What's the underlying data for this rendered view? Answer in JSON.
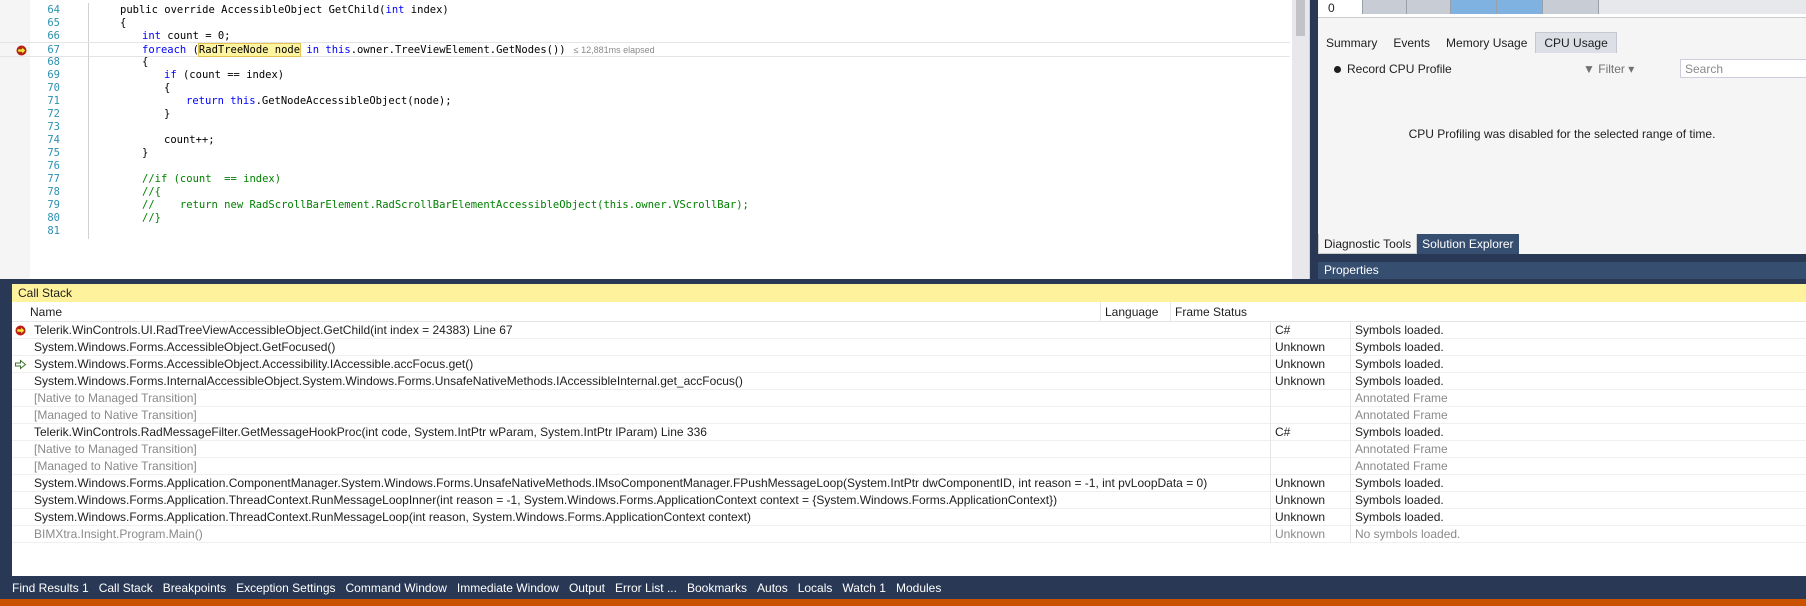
{
  "editor": {
    "lines": [
      {
        "num": "64",
        "parts": [
          [
            "",
            "public override AccessibleObject GetChild("
          ],
          [
            "kw",
            "int"
          ],
          [
            "",
            " index)"
          ]
        ],
        "indent": 3
      },
      {
        "num": "65",
        "parts": [
          [
            "",
            "{"
          ]
        ],
        "indent": 3
      },
      {
        "num": "66",
        "parts": [
          [
            "kw",
            "int"
          ],
          [
            "",
            " count = 0;"
          ]
        ],
        "indent": 4
      },
      {
        "num": "67",
        "parts": [
          [
            "kw",
            "foreach"
          ],
          [
            "",
            " ("
          ],
          [
            "hl",
            "RadTreeNode node"
          ],
          [
            "",
            " "
          ],
          [
            "kw",
            "in"
          ],
          [
            "",
            " "
          ],
          [
            "kw",
            "this"
          ],
          [
            "",
            ".owner.TreeViewElement.GetNodes())"
          ]
        ],
        "indent": 4,
        "current": true,
        "perf": "≤ 12,881ms elapsed"
      },
      {
        "num": "68",
        "parts": [
          [
            "",
            "{"
          ]
        ],
        "indent": 4
      },
      {
        "num": "69",
        "parts": [
          [
            "kw",
            "if"
          ],
          [
            "",
            " (count == index)"
          ]
        ],
        "indent": 5
      },
      {
        "num": "70",
        "parts": [
          [
            "",
            "{"
          ]
        ],
        "indent": 5
      },
      {
        "num": "71",
        "parts": [
          [
            "kw",
            "return"
          ],
          [
            "",
            " "
          ],
          [
            "kw",
            "this"
          ],
          [
            "",
            ".GetNodeAccessibleObject(node);"
          ]
        ],
        "indent": 6
      },
      {
        "num": "72",
        "parts": [
          [
            "",
            "}"
          ]
        ],
        "indent": 5
      },
      {
        "num": "73",
        "parts": [],
        "indent": 5
      },
      {
        "num": "74",
        "parts": [
          [
            "",
            "count++;"
          ]
        ],
        "indent": 5
      },
      {
        "num": "75",
        "parts": [
          [
            "",
            "}"
          ]
        ],
        "indent": 4
      },
      {
        "num": "76",
        "parts": [],
        "indent": 4
      },
      {
        "num": "77",
        "parts": [
          [
            "cm",
            "//if (count  == index)"
          ]
        ],
        "indent": 4
      },
      {
        "num": "78",
        "parts": [
          [
            "cm",
            "//{"
          ]
        ],
        "indent": 4
      },
      {
        "num": "79",
        "parts": [
          [
            "cm",
            "//    return new RadScrollBarElement.RadScrollBarElementAccessibleObject(this.owner.VScrollBar);"
          ]
        ],
        "indent": 4
      },
      {
        "num": "80",
        "parts": [
          [
            "cm",
            "//}"
          ]
        ],
        "indent": 4
      },
      {
        "num": "81",
        "parts": [],
        "indent": 4
      }
    ]
  },
  "diagnostics": {
    "timeline_value": "0",
    "tabs": [
      {
        "label": "Summary",
        "active": false
      },
      {
        "label": "Events",
        "active": false
      },
      {
        "label": "Memory Usage",
        "active": false
      },
      {
        "label": "CPU Usage",
        "active": true
      }
    ],
    "record_label": "Record CPU Profile",
    "filter_label": "Filter",
    "search_placeholder": "Search",
    "message": "CPU Profiling was disabled for the selected range of time."
  },
  "panel_tabs": [
    {
      "label": "Diagnostic Tools",
      "active": true
    },
    {
      "label": "Solution Explorer",
      "active": false
    }
  ],
  "properties_title": "Properties",
  "call_stack": {
    "title": "Call Stack",
    "columns": {
      "name": "Name",
      "language": "Language",
      "status": "Frame Status"
    },
    "rows": [
      {
        "icon": "current",
        "name": "Telerik.WinControls.UI.RadTreeViewAccessibleObject.GetChild(int index = 24383) Line 67",
        "language": "C#",
        "status": "Symbols loaded."
      },
      {
        "icon": "",
        "name": "System.Windows.Forms.AccessibleObject.GetFocused()",
        "language": "Unknown",
        "status": "Symbols loaded."
      },
      {
        "icon": "return",
        "name": "System.Windows.Forms.AccessibleObject.Accessibility.IAccessible.accFocus.get()",
        "language": "Unknown",
        "status": "Symbols loaded."
      },
      {
        "icon": "",
        "name": "System.Windows.Forms.InternalAccessibleObject.System.Windows.Forms.UnsafeNativeMethods.IAccessibleInternal.get_accFocus()",
        "language": "Unknown",
        "status": "Symbols loaded."
      },
      {
        "icon": "",
        "name": "[Native to Managed Transition]",
        "language": "",
        "status": "Annotated Frame",
        "annotated": true
      },
      {
        "icon": "",
        "name": "[Managed to Native Transition]",
        "language": "",
        "status": "Annotated Frame",
        "annotated": true
      },
      {
        "icon": "",
        "name": "Telerik.WinControls.RadMessageFilter.GetMessageHookProc(int code, System.IntPtr wParam, System.IntPtr lParam) Line 336",
        "language": "C#",
        "status": "Symbols loaded."
      },
      {
        "icon": "",
        "name": "[Native to Managed Transition]",
        "language": "",
        "status": "Annotated Frame",
        "annotated": true
      },
      {
        "icon": "",
        "name": "[Managed to Native Transition]",
        "language": "",
        "status": "Annotated Frame",
        "annotated": true
      },
      {
        "icon": "",
        "name": "System.Windows.Forms.Application.ComponentManager.System.Windows.Forms.UnsafeNativeMethods.IMsoComponentManager.FPushMessageLoop(System.IntPtr dwComponentID, int reason = -1, int pvLoopData = 0)",
        "language": "Unknown",
        "status": "Symbols loaded."
      },
      {
        "icon": "",
        "name": "System.Windows.Forms.Application.ThreadContext.RunMessageLoopInner(int reason = -1, System.Windows.Forms.ApplicationContext context = {System.Windows.Forms.ApplicationContext})",
        "language": "Unknown",
        "status": "Symbols loaded."
      },
      {
        "icon": "",
        "name": "System.Windows.Forms.Application.ThreadContext.RunMessageLoop(int reason, System.Windows.Forms.ApplicationContext context)",
        "language": "Unknown",
        "status": "Symbols loaded."
      },
      {
        "icon": "",
        "name": "BIMXtra.Insight.Program.Main()",
        "language": "Unknown",
        "status": "No symbols loaded.",
        "annotated": true
      }
    ]
  },
  "bottom_tabs": [
    "Find Results 1",
    "Call Stack",
    "Breakpoints",
    "Exception Settings",
    "Command Window",
    "Immediate Window",
    "Output",
    "Error List ...",
    "Bookmarks",
    "Autos",
    "Locals",
    "Watch 1",
    "Modules"
  ]
}
